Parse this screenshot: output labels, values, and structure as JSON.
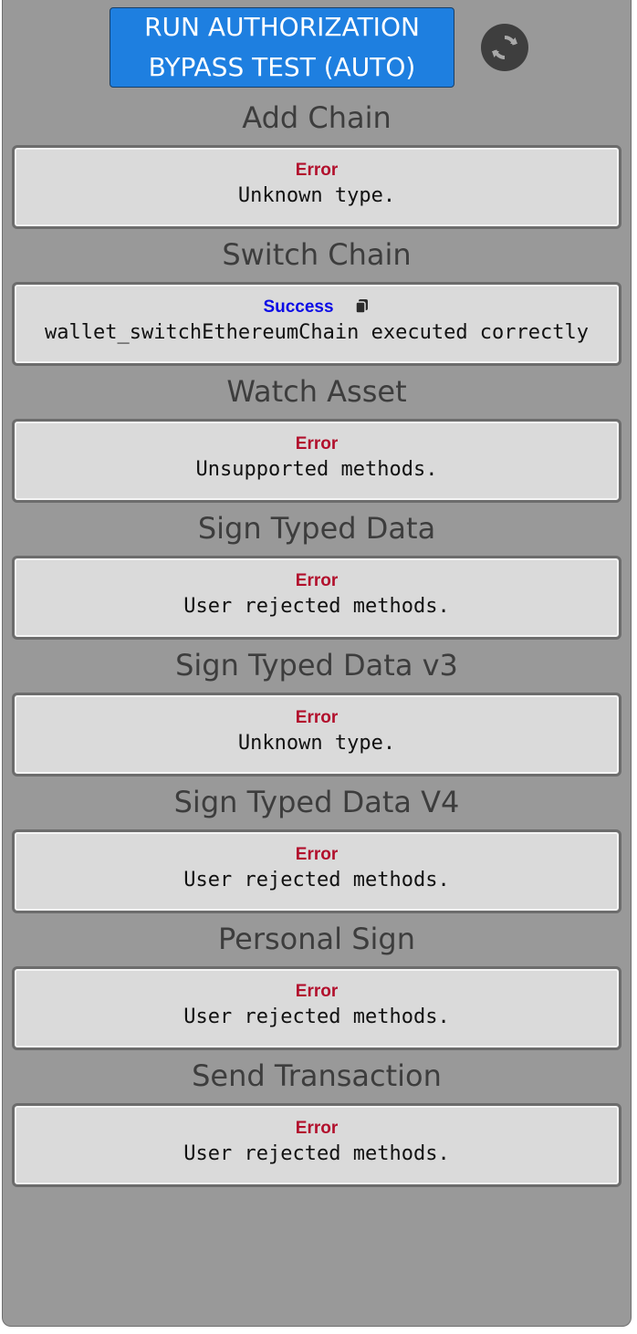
{
  "run_button": {
    "line1": "RUN AUTHORIZATION",
    "line2": "BYPASS TEST (AUTO)"
  },
  "refresh_icon": "refresh-icon",
  "colors": {
    "run_button": "#1e7fe0",
    "panel": "#999999",
    "error": "#b20f2c",
    "success": "#0b0be6"
  },
  "sections": [
    {
      "title": "Add Chain",
      "status": "Error",
      "status_type": "error",
      "message": "Unknown type."
    },
    {
      "title": "Switch Chain",
      "status": "Success",
      "status_type": "success",
      "message": "wallet_switchEthereumChain executed correctly",
      "has_copy_icon": true
    },
    {
      "title": "Watch Asset",
      "status": "Error",
      "status_type": "error",
      "message": "Unsupported methods."
    },
    {
      "title": "Sign Typed Data",
      "status": "Error",
      "status_type": "error",
      "message": "User rejected methods."
    },
    {
      "title": "Sign Typed Data v3",
      "status": "Error",
      "status_type": "error",
      "message": "Unknown type."
    },
    {
      "title": "Sign Typed Data V4",
      "status": "Error",
      "status_type": "error",
      "message": "User rejected methods."
    },
    {
      "title": "Personal Sign",
      "status": "Error",
      "status_type": "error",
      "message": "User rejected methods."
    },
    {
      "title": "Send Transaction",
      "status": "Error",
      "status_type": "error",
      "message": "User rejected methods."
    }
  ]
}
